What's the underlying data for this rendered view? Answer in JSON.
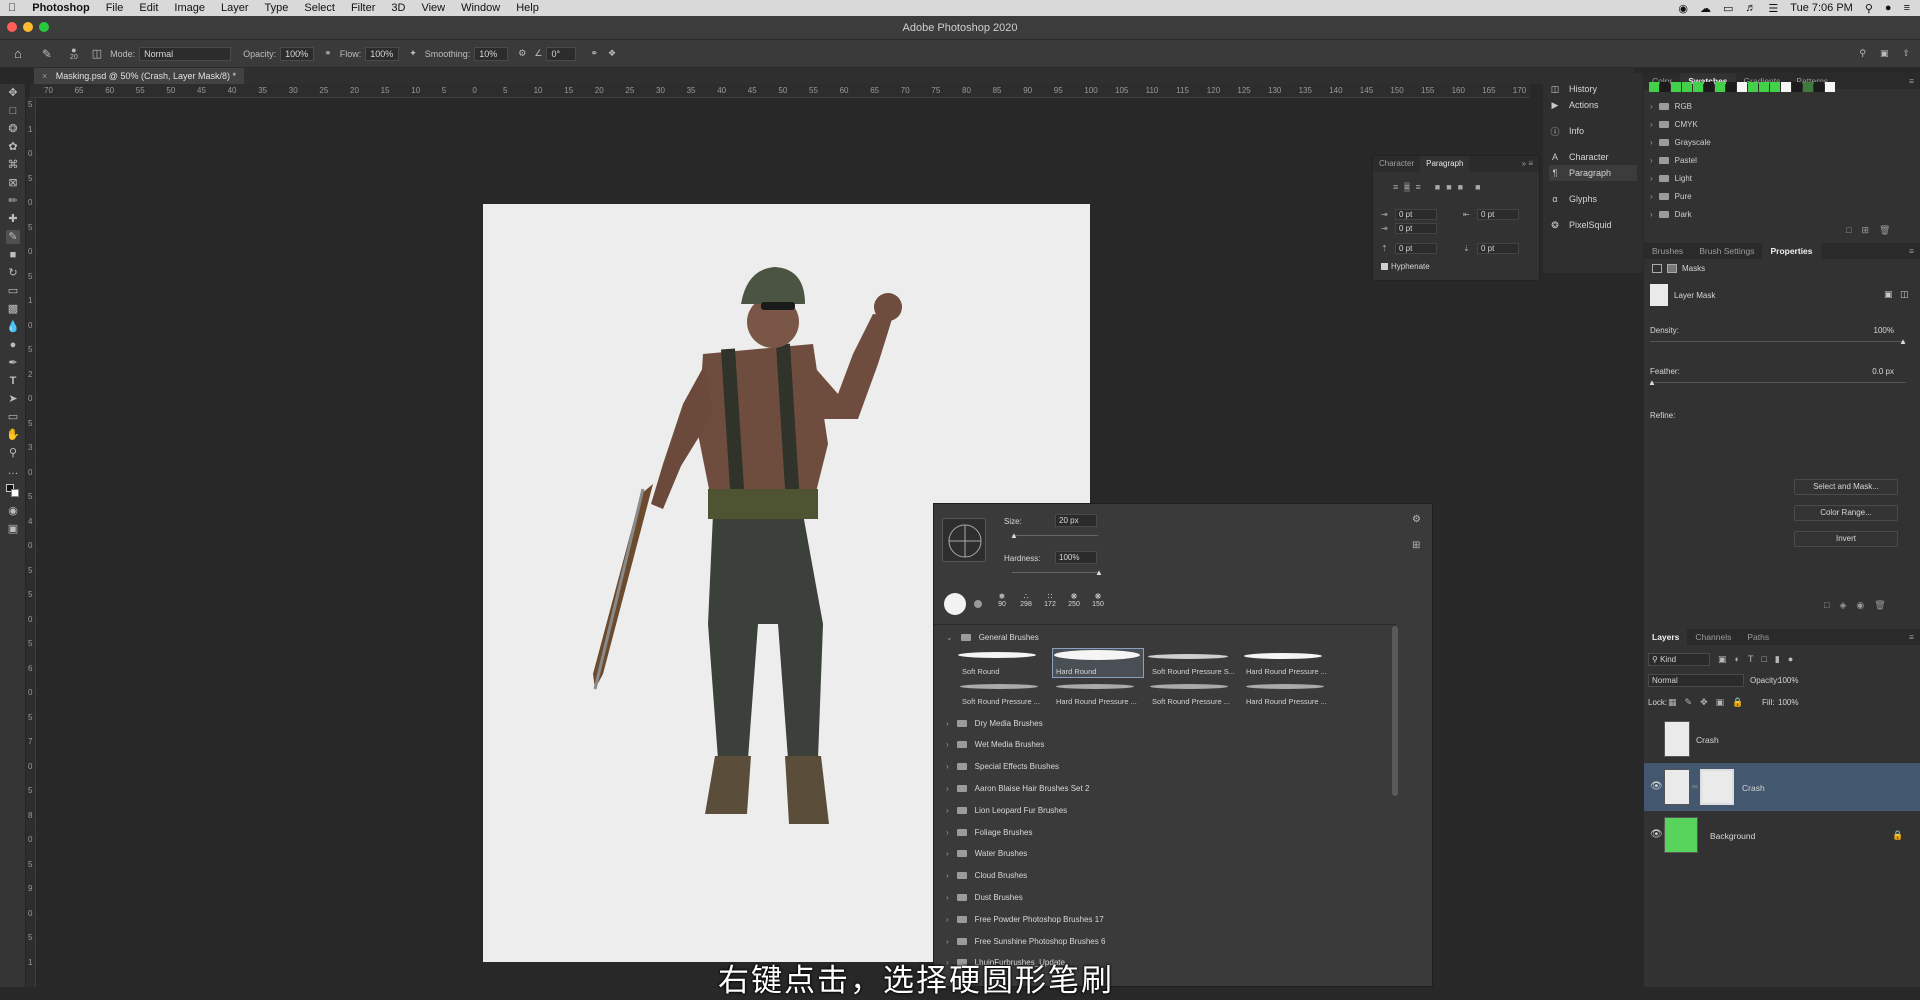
{
  "menubar": {
    "app": "Photoshop",
    "items": [
      "File",
      "Edit",
      "Image",
      "Layer",
      "Type",
      "Select",
      "Filter",
      "3D",
      "View",
      "Window",
      "Help"
    ],
    "clock": "Tue 7:06 PM"
  },
  "window": {
    "title": "Adobe Photoshop 2020"
  },
  "options": {
    "brush_size": "20",
    "mode_label": "Mode:",
    "mode_value": "Normal",
    "opacity_label": "Opacity:",
    "opacity_value": "100%",
    "flow_label": "Flow:",
    "flow_value": "100%",
    "smoothing_label": "Smoothing:",
    "smoothing_value": "10%",
    "angle_value": "0°"
  },
  "document": {
    "tab": "Masking.psd @ 50% (Crash, Layer Mask/8) *"
  },
  "ruler": {
    "h_ticks": [
      "70",
      "65",
      "60",
      "55",
      "50",
      "45",
      "40",
      "35",
      "30",
      "25",
      "20",
      "15",
      "10",
      "5",
      "0",
      "5",
      "10",
      "15",
      "20",
      "25",
      "30",
      "35",
      "40",
      "45",
      "50",
      "55",
      "60",
      "65",
      "70",
      "75",
      "80",
      "85",
      "90",
      "95",
      "100",
      "105",
      "110",
      "115",
      "120",
      "125",
      "130",
      "135",
      "140",
      "145",
      "150",
      "155",
      "160",
      "165",
      "170"
    ],
    "v_ticks": [
      "5",
      "1",
      "0",
      "5",
      "0",
      "5",
      "0",
      "5",
      "1",
      "0",
      "5",
      "2",
      "0",
      "5",
      "3",
      "0",
      "5",
      "4",
      "0",
      "5",
      "5",
      "0",
      "5",
      "6",
      "0",
      "5",
      "7",
      "0",
      "5",
      "8",
      "0",
      "5",
      "9",
      "0",
      "5",
      "1"
    ]
  },
  "character_panel": {
    "tabs": [
      "Character",
      "Paragraph"
    ],
    "active_tab": "Paragraph",
    "fields": [
      "0 pt",
      "0 pt",
      "0 pt",
      "0 pt",
      "0 pt"
    ],
    "hyphenate": "Hyphenate"
  },
  "collapsed_panels": {
    "items": [
      "History",
      "Actions",
      "Info",
      "Character",
      "Paragraph",
      "Glyphs",
      "PixelSquid"
    ]
  },
  "swatches_panel": {
    "tabs": [
      "Color",
      "Swatches",
      "Gradients",
      "Patterns"
    ],
    "active_tab": "Swatches",
    "recent_colors": [
      "#44d14a",
      "#1b1b1b",
      "#44d14a",
      "#44d14a",
      "#44d14a",
      "#1b1b1b",
      "#44d14a",
      "#1b1b1b",
      "#f5f5f5",
      "#44d14a",
      "#44d14a",
      "#44d14a",
      "#f5f5f5",
      "#1b1b1b",
      "#3f7a3f",
      "#1b1b1b",
      "#f5f5f5"
    ],
    "folders": [
      "RGB",
      "CMYK",
      "Grayscale",
      "Pastel",
      "Light",
      "Pure",
      "Dark"
    ]
  },
  "properties_panel": {
    "tabs": [
      "Brushes",
      "Brush Settings",
      "Properties"
    ],
    "active_tab": "Properties",
    "section": "Masks",
    "layer_mask_label": "Layer Mask",
    "density_label": "Density:",
    "density_value": "100%",
    "feather_label": "Feather:",
    "feather_value": "0.0 px",
    "refine_label": "Refine:",
    "buttons": [
      "Select and Mask...",
      "Color Range...",
      "Invert"
    ]
  },
  "layers_panel": {
    "tabs": [
      "Layers",
      "Channels",
      "Paths"
    ],
    "active_tab": "Layers",
    "kind_label": "Kind",
    "blend_mode": "Normal",
    "opacity_label": "Opacity:",
    "opacity_value": "100%",
    "lock_label": "Lock:",
    "fill_label": "Fill:",
    "fill_value": "100%",
    "layers": [
      {
        "name": "Crash",
        "visible": false,
        "selected": false
      },
      {
        "name": "Crash",
        "visible": true,
        "selected": true
      },
      {
        "name": "Background",
        "visible": true,
        "selected": false
      }
    ]
  },
  "brush_picker": {
    "size_label": "Size:",
    "size_value": "20 px",
    "hardness_label": "Hardness:",
    "hardness_value": "100%",
    "recent_sizes": [
      "90",
      "298",
      "172",
      "250",
      "150"
    ],
    "general_folder": "General Brushes",
    "general_brushes": [
      "Soft Round",
      "Hard Round",
      "Soft Round Pressure S...",
      "Hard Round Pressure ...",
      "Soft Round Pressure ...",
      "Hard Round Pressure ...",
      "Soft Round Pressure ...",
      "Hard Round Pressure ..."
    ],
    "folders": [
      "Dry Media Brushes",
      "Wet Media Brushes",
      "Special Effects Brushes",
      "Aaron Blaise Hair Brushes Set 2",
      "Lion Leopard Fur Brushes",
      "Foliage Brushes",
      "Water Brushes",
      "Cloud Brushes",
      "Dust Brushes",
      "Free Powder Photoshop Brushes 17",
      "Free Sunshine Photoshop Brushes 6",
      "LhuinFurbrushes_Update"
    ]
  },
  "subtitle": "右键点击，选择硬圆形笔刷"
}
